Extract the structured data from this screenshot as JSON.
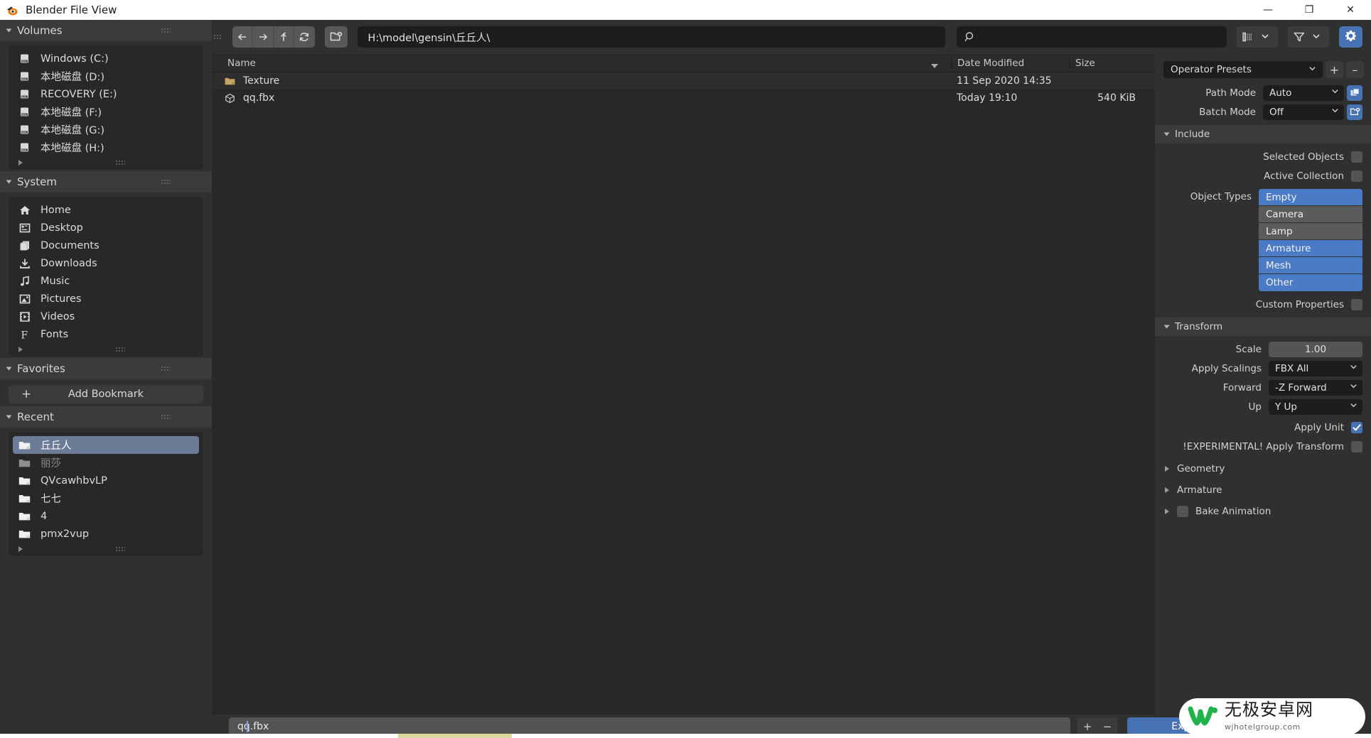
{
  "titlebar": {
    "title": "Blender File View",
    "logo_icon": "blender-logo-icon",
    "minimize_label": "—",
    "maximize_label": "❐",
    "close_label": "✕"
  },
  "sidebar": {
    "sections": [
      {
        "name": "Volumes",
        "title": "Volumes",
        "items": [
          {
            "label": "Windows (C:)",
            "icon": "disk-drive-icon"
          },
          {
            "label": "本地磁盘 (D:)",
            "icon": "disk-drive-icon"
          },
          {
            "label": "RECOVERY (E:)",
            "icon": "disk-drive-icon"
          },
          {
            "label": "本地磁盘 (F:)",
            "icon": "disk-drive-icon"
          },
          {
            "label": "本地磁盘 (G:)",
            "icon": "disk-drive-icon"
          },
          {
            "label": "本地磁盘 (H:)",
            "icon": "disk-drive-icon"
          }
        ]
      },
      {
        "name": "System",
        "title": "System",
        "items": [
          {
            "label": "Home",
            "icon": "home-icon"
          },
          {
            "label": "Desktop",
            "icon": "desktop-icon"
          },
          {
            "label": "Documents",
            "icon": "documents-icon"
          },
          {
            "label": "Downloads",
            "icon": "download-icon"
          },
          {
            "label": "Music",
            "icon": "music-note-icon"
          },
          {
            "label": "Pictures",
            "icon": "picture-icon"
          },
          {
            "label": "Videos",
            "icon": "film-icon"
          },
          {
            "label": "Fonts",
            "icon": "font-f-icon"
          }
        ]
      }
    ],
    "favorites": {
      "title": "Favorites",
      "add_bookmark_label": "Add Bookmark",
      "add_bookmark_icon": "plus-icon"
    },
    "recent": {
      "title": "Recent",
      "close_icon": "close-icon",
      "items": [
        {
          "label": "丘丘人",
          "icon": "folder-icon",
          "state": "active"
        },
        {
          "label": "丽莎",
          "icon": "folder-icon",
          "state": "dim"
        },
        {
          "label": "QVcawhbvLP",
          "icon": "folder-icon",
          "state": "normal"
        },
        {
          "label": "七七",
          "icon": "folder-icon",
          "state": "normal"
        },
        {
          "label": "4",
          "icon": "folder-icon",
          "state": "normal"
        },
        {
          "label": "pmx2vup",
          "icon": "folder-icon",
          "state": "normal"
        }
      ]
    }
  },
  "topbar": {
    "back_icon": "arrow-left-icon",
    "forward_icon": "arrow-right-icon",
    "up_icon": "arrow-up-parent-icon",
    "refresh_icon": "refresh-icon",
    "new_folder_icon": "new-folder-icon",
    "path_value": "H:\\model\\gensin\\丘丘人\\",
    "search_placeholder": "",
    "search_icon": "search-icon",
    "display_mode_icon": "list-display-icon",
    "filter_icon": "funnel-filter-icon",
    "chevron_icon": "chevron-down-icon",
    "settings_icon": "gear-icon"
  },
  "filelist": {
    "columns": {
      "name": "Name",
      "date": "Date Modified",
      "size": "Size"
    },
    "sort_icon": "sort-descending-icon",
    "rows": [
      {
        "name": "Texture",
        "icon": "folder-icon",
        "date": "11 Sep 2020 14:35",
        "size": ""
      },
      {
        "name": "qq.fbx",
        "icon": "mesh-object-icon",
        "date": "Today 19:10",
        "size": "540 KiB"
      }
    ]
  },
  "properties": {
    "preset": {
      "value": "Operator Presets",
      "add_label": "+",
      "remove_label": "–",
      "chevron_icon": "chevron-down-icon"
    },
    "path_mode": {
      "label": "Path Mode",
      "value": "Auto",
      "icon": "copy-paths-icon"
    },
    "batch_mode": {
      "label": "Batch Mode",
      "value": "Off",
      "icon": "new-folder-icon"
    },
    "include": {
      "title": "Include",
      "selected_objects": {
        "label": "Selected Objects",
        "checked": false
      },
      "active_collection": {
        "label": "Active Collection",
        "checked": false
      },
      "object_types_label": "Object Types",
      "object_types": [
        {
          "label": "Empty",
          "selected": true
        },
        {
          "label": "Camera",
          "selected": false
        },
        {
          "label": "Lamp",
          "selected": false
        },
        {
          "label": "Armature",
          "selected": true
        },
        {
          "label": "Mesh",
          "selected": true
        },
        {
          "label": "Other",
          "selected": true
        }
      ],
      "custom_properties": {
        "label": "Custom Properties",
        "checked": false
      }
    },
    "transform": {
      "title": "Transform",
      "scale": {
        "label": "Scale",
        "value": "1.00"
      },
      "apply_scalings": {
        "label": "Apply Scalings",
        "value": "FBX All"
      },
      "forward": {
        "label": "Forward",
        "value": "-Z Forward"
      },
      "up": {
        "label": "Up",
        "value": "Y Up"
      },
      "apply_unit": {
        "label": "Apply Unit",
        "checked": true
      },
      "apply_transform": {
        "label": "!EXPERIMENTAL! Apply Transform",
        "checked": false
      }
    },
    "collapsed_sections": [
      {
        "label": "Geometry",
        "has_checkbox": false,
        "checked": false
      },
      {
        "label": "Armature",
        "has_checkbox": false,
        "checked": false
      },
      {
        "label": "Bake Animation",
        "has_checkbox": true,
        "checked": false
      }
    ]
  },
  "bottombar": {
    "filename_value": "qq.fbx",
    "increment_label": "+",
    "decrement_label": "−",
    "export_label": "Export FBX"
  },
  "watermark": {
    "logo_icon": "w-logo-icon",
    "cn_text": "无极安卓网",
    "en_text": "wjhotelgroup.com"
  },
  "colors": {
    "accent_blue": "#4772b3",
    "selection_blue": "#4b7bc4",
    "panel_bg": "#303030",
    "list_bg": "#282828",
    "field_bg": "#1d1d1d",
    "folder_gold": "#c8a464"
  }
}
